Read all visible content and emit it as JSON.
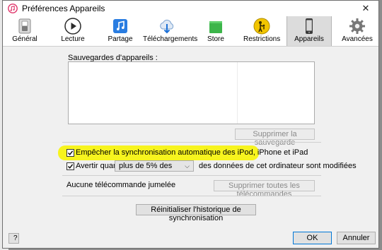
{
  "window": {
    "title": "Préférences Appareils",
    "close_glyph": "✕"
  },
  "toolbar": {
    "items": [
      {
        "label": "Général",
        "icon": "switch-icon"
      },
      {
        "label": "Lecture",
        "icon": "play-icon"
      },
      {
        "label": "Partage",
        "icon": "music-note-icon"
      },
      {
        "label": "Téléchargements",
        "icon": "cloud-download-icon"
      },
      {
        "label": "Store",
        "icon": "shopping-bag-icon"
      },
      {
        "label": "Restrictions",
        "icon": "parental-icon"
      },
      {
        "label": "Appareils",
        "icon": "phone-icon",
        "active": true
      },
      {
        "label": "Avancées",
        "icon": "gear-icon"
      }
    ]
  },
  "backups": {
    "label": "Sauvegardes d'appareils :",
    "delete_button": "Supprimer la sauvegarde"
  },
  "options": {
    "prevent_sync": {
      "label": "Empêcher la synchronisation automatique des iPod, iPhone et iPad",
      "checked": true
    },
    "warn_when": {
      "label": "Avertir quand",
      "checked": true,
      "select_value": "plus de 5% des",
      "suffix": "des données de cet ordinateur sont modifiées"
    }
  },
  "remotes": {
    "label": "Aucune télécommande jumelée",
    "remove_button": "Supprimer toutes les télécommandes"
  },
  "reset_button": "Réinitialiser l'historique de synchronisation",
  "footer": {
    "help": "?",
    "ok": "OK",
    "cancel": "Annuler"
  },
  "colors": {
    "highlight": "#f7f41e",
    "accent": "#0078d7"
  }
}
